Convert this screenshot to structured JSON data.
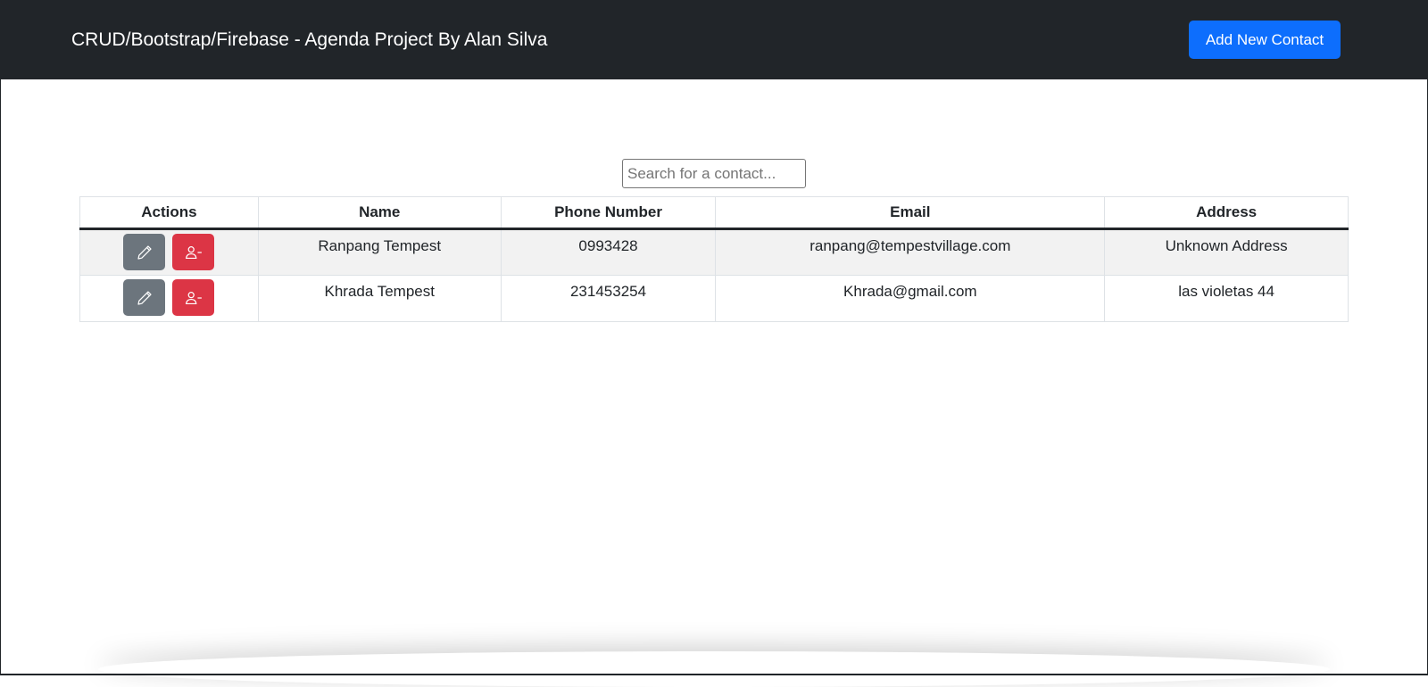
{
  "navbar": {
    "brand": "CRUD/Bootstrap/Firebase - Agenda Project By Alan Silva",
    "add_button_label": "Add New Contact"
  },
  "search": {
    "placeholder": "Search for a contact...",
    "value": ""
  },
  "table": {
    "columns": [
      "Actions",
      "Name",
      "Phone Number",
      "Email",
      "Address"
    ],
    "rows": [
      {
        "name": "Ranpang Tempest",
        "phone": "0993428",
        "email": "ranpang@tempestvillage.com",
        "address": "Unknown Address"
      },
      {
        "name": "Khrada Tempest",
        "phone": "231453254",
        "email": "Khrada@gmail.com",
        "address": "las violetas 44"
      }
    ],
    "row_actions": {
      "edit_icon": "pencil-icon",
      "delete_icon": "person-dash-icon"
    }
  },
  "colors": {
    "navbar_bg": "#212529",
    "primary": "#0d6efd",
    "secondary": "#6c757d",
    "danger": "#dc3545"
  }
}
